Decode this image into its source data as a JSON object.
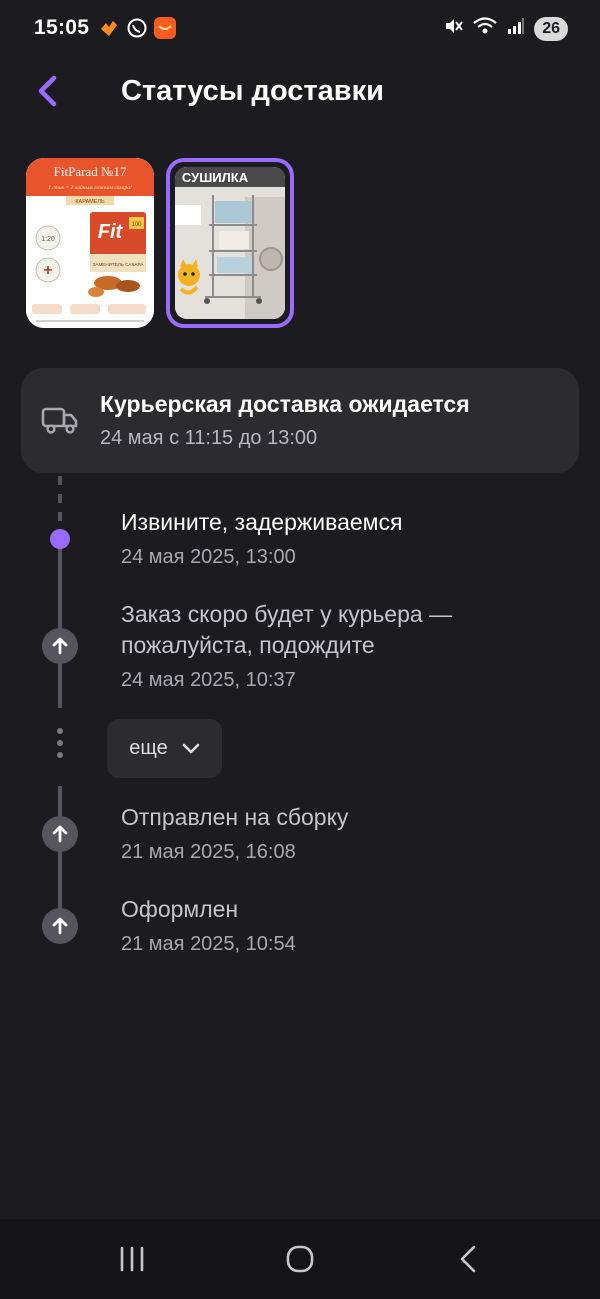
{
  "status_bar": {
    "time": "15:05",
    "battery": "26",
    "icons": [
      "likee-icon",
      "viber-icon",
      "aliexpress-icon",
      "mute-icon",
      "wifi-icon",
      "signal-icon"
    ]
  },
  "header": {
    "title": "Статусы доставки",
    "back_icon": "chevron-left-icon"
  },
  "products": [
    {
      "name": "fitparad-sweetener",
      "title": "FitParad №17",
      "tagline": "1 стик = 2 чайным ложкам сахара!",
      "flavor": "КАРАМЕЛЬ",
      "brand": "Fit",
      "badge": "100",
      "product": "ЗАМЕНИТЕЛЬ САХАРА",
      "ratio": "1:20"
    },
    {
      "name": "dryer-rack",
      "title": "СУШИЛКА",
      "selected": true
    }
  ],
  "delivery_card": {
    "icon": "truck-icon",
    "title": "Курьерская доставка ожидается",
    "subtitle": "24 мая с 11:15 до 13:00"
  },
  "timeline": {
    "events": [
      {
        "title": "Извините, задерживаемся",
        "date": "24 мая 2025, 13:00",
        "active": true
      },
      {
        "title_line1": "Заказ скоро будет у курьера —",
        "title_line2": "пожалуйста, подождите",
        "date": "24 мая 2025, 10:37"
      },
      {
        "title": "Отправлен на сборку",
        "date": "21 мая 2025, 16:08"
      },
      {
        "title": "Оформлен",
        "date": "21 мая 2025, 10:54"
      }
    ],
    "more_label": "еще"
  },
  "nav_bar": {
    "icons": [
      "recents-icon",
      "home-icon",
      "back-icon"
    ]
  },
  "colors": {
    "accent": "#9a6bff",
    "background": "#1c1b1f",
    "card": "#2c2b30",
    "timeline": "#56545c"
  }
}
